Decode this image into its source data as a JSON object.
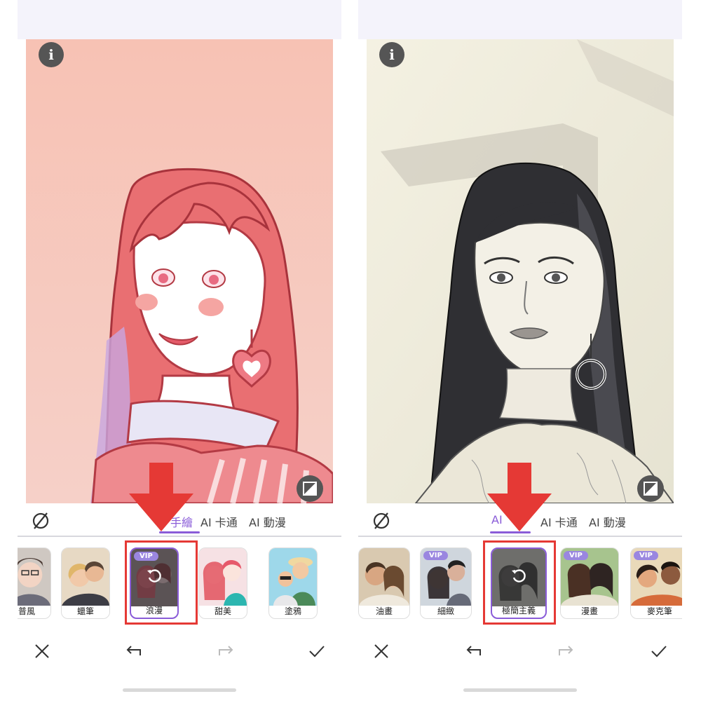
{
  "panels": [
    {
      "tabs": [
        "手繪",
        "AI 卡通",
        "AI 動漫"
      ],
      "styles": [
        {
          "label": "普風",
          "vip": false
        },
        {
          "label": "蠟筆",
          "vip": false
        },
        {
          "label": "浪漫",
          "vip": true,
          "selected": true
        },
        {
          "label": "甜美",
          "vip": false
        },
        {
          "label": "塗鴉",
          "vip": false
        }
      ]
    },
    {
      "tabs": [
        "AI",
        "AI 卡通",
        "AI 動漫"
      ],
      "styles": [
        {
          "label": "油畫",
          "vip": false
        },
        {
          "label": "細緻",
          "vip": true
        },
        {
          "label": "極簡主義",
          "vip": true,
          "selected": true
        },
        {
          "label": "漫畫",
          "vip": true
        },
        {
          "label": "麥克筆",
          "vip": true
        }
      ]
    }
  ],
  "common": {
    "info_glyph": "i",
    "vip_text": "VIP"
  },
  "icons": {
    "info": "info-icon",
    "compare": "compare-icon",
    "none": "no-effect-icon",
    "reset": "reset-icon",
    "close": "close-icon",
    "undo": "undo-icon",
    "redo": "redo-icon",
    "confirm": "check-icon"
  },
  "colors": {
    "accent": "#8a5cd8",
    "highlight_red": "#e53935",
    "vip_badge": "#9a86e0",
    "top_bar": "#f4f3fb"
  }
}
